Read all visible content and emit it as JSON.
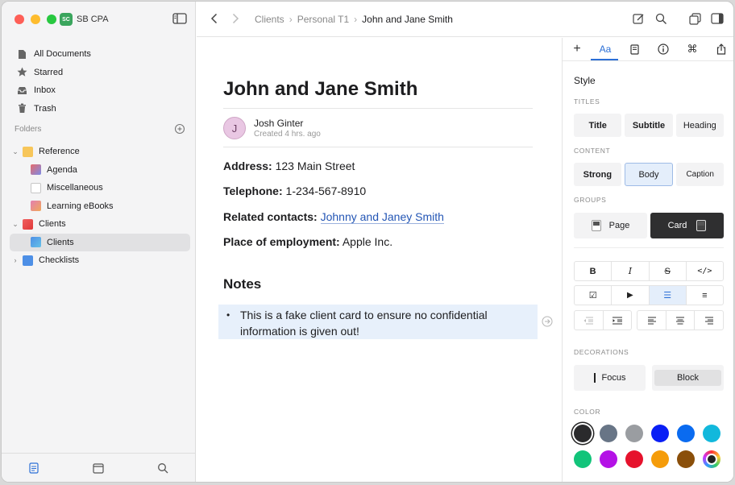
{
  "app": {
    "name": "SB CPA",
    "badge": "SC"
  },
  "sidebar": {
    "nav": [
      {
        "label": "All Documents",
        "icon": "document-icon"
      },
      {
        "label": "Starred",
        "icon": "star-icon"
      },
      {
        "label": "Inbox",
        "icon": "inbox-icon"
      },
      {
        "label": "Trash",
        "icon": "trash-icon"
      }
    ],
    "folders_label": "Folders",
    "tree": [
      {
        "label": "Reference",
        "level": 0,
        "expanded": true,
        "icon_color": "#f5b942"
      },
      {
        "label": "Agenda",
        "level": 1,
        "icon_color": "#e66b6b"
      },
      {
        "label": "Miscellaneous",
        "level": 1,
        "icon_color": "#cfcfcf"
      },
      {
        "label": "Learning eBooks",
        "level": 1,
        "icon_color": "#e37fb0"
      },
      {
        "label": "Clients",
        "level": 0,
        "expanded": true,
        "icon_color": "#e24a4a"
      },
      {
        "label": "Clients",
        "level": 1,
        "selected": true,
        "icon_color": "#4d8fe6"
      },
      {
        "label": "Checklists",
        "level": 0,
        "expanded": false,
        "icon_color": "#4d8fe6"
      }
    ]
  },
  "toolbar": {
    "breadcrumbs": [
      "Clients",
      "Personal T1",
      "John and Jane Smith"
    ]
  },
  "document": {
    "title": "John and Jane Smith",
    "author": {
      "initial": "J",
      "name": "Josh Ginter",
      "meta": "Created 4 hrs. ago"
    },
    "fields": [
      {
        "label": "Address:",
        "value": "123 Main Street"
      },
      {
        "label": "Telephone:",
        "value": "1-234-567-8910"
      },
      {
        "label": "Related contacts:",
        "value": "Johnny and Janey Smith",
        "link": true
      },
      {
        "label": "Place of employment:",
        "value": "Apple Inc."
      }
    ],
    "notes_heading": "Notes",
    "note_bullet": "•",
    "note_text": "This is a fake client card to ensure no confidential information is given out!"
  },
  "panel": {
    "tabs": [
      "+",
      "Aa",
      "doc",
      "info",
      "cmd",
      "share"
    ],
    "active_tab": "Aa",
    "style_heading": "Style",
    "titles_label": "TITLES",
    "titles": [
      "Title",
      "Subtitle",
      "Heading"
    ],
    "content_label": "CONTENT",
    "content": [
      "Strong",
      "Body",
      "Caption"
    ],
    "content_selected": "Body",
    "groups_label": "GROUPS",
    "groups": [
      "Page",
      "Card"
    ],
    "format_row": [
      "B",
      "I",
      "S",
      "</>"
    ],
    "list_row": [
      "☑",
      "▶",
      "☰",
      "≡"
    ],
    "decorations_label": "DECORATIONS",
    "decorations": [
      "Focus",
      "Block"
    ],
    "color_label": "COLOR",
    "colors": [
      "#2a2a2c",
      "#687586",
      "#9a9da1",
      "#0a1ff5",
      "#0a6bf0",
      "#12b8dc",
      "#12c47a",
      "#b412e6",
      "#e6122c",
      "#f59c0a",
      "#8a4f0a",
      "#ffffff"
    ],
    "accent": "#2b6fd6"
  }
}
